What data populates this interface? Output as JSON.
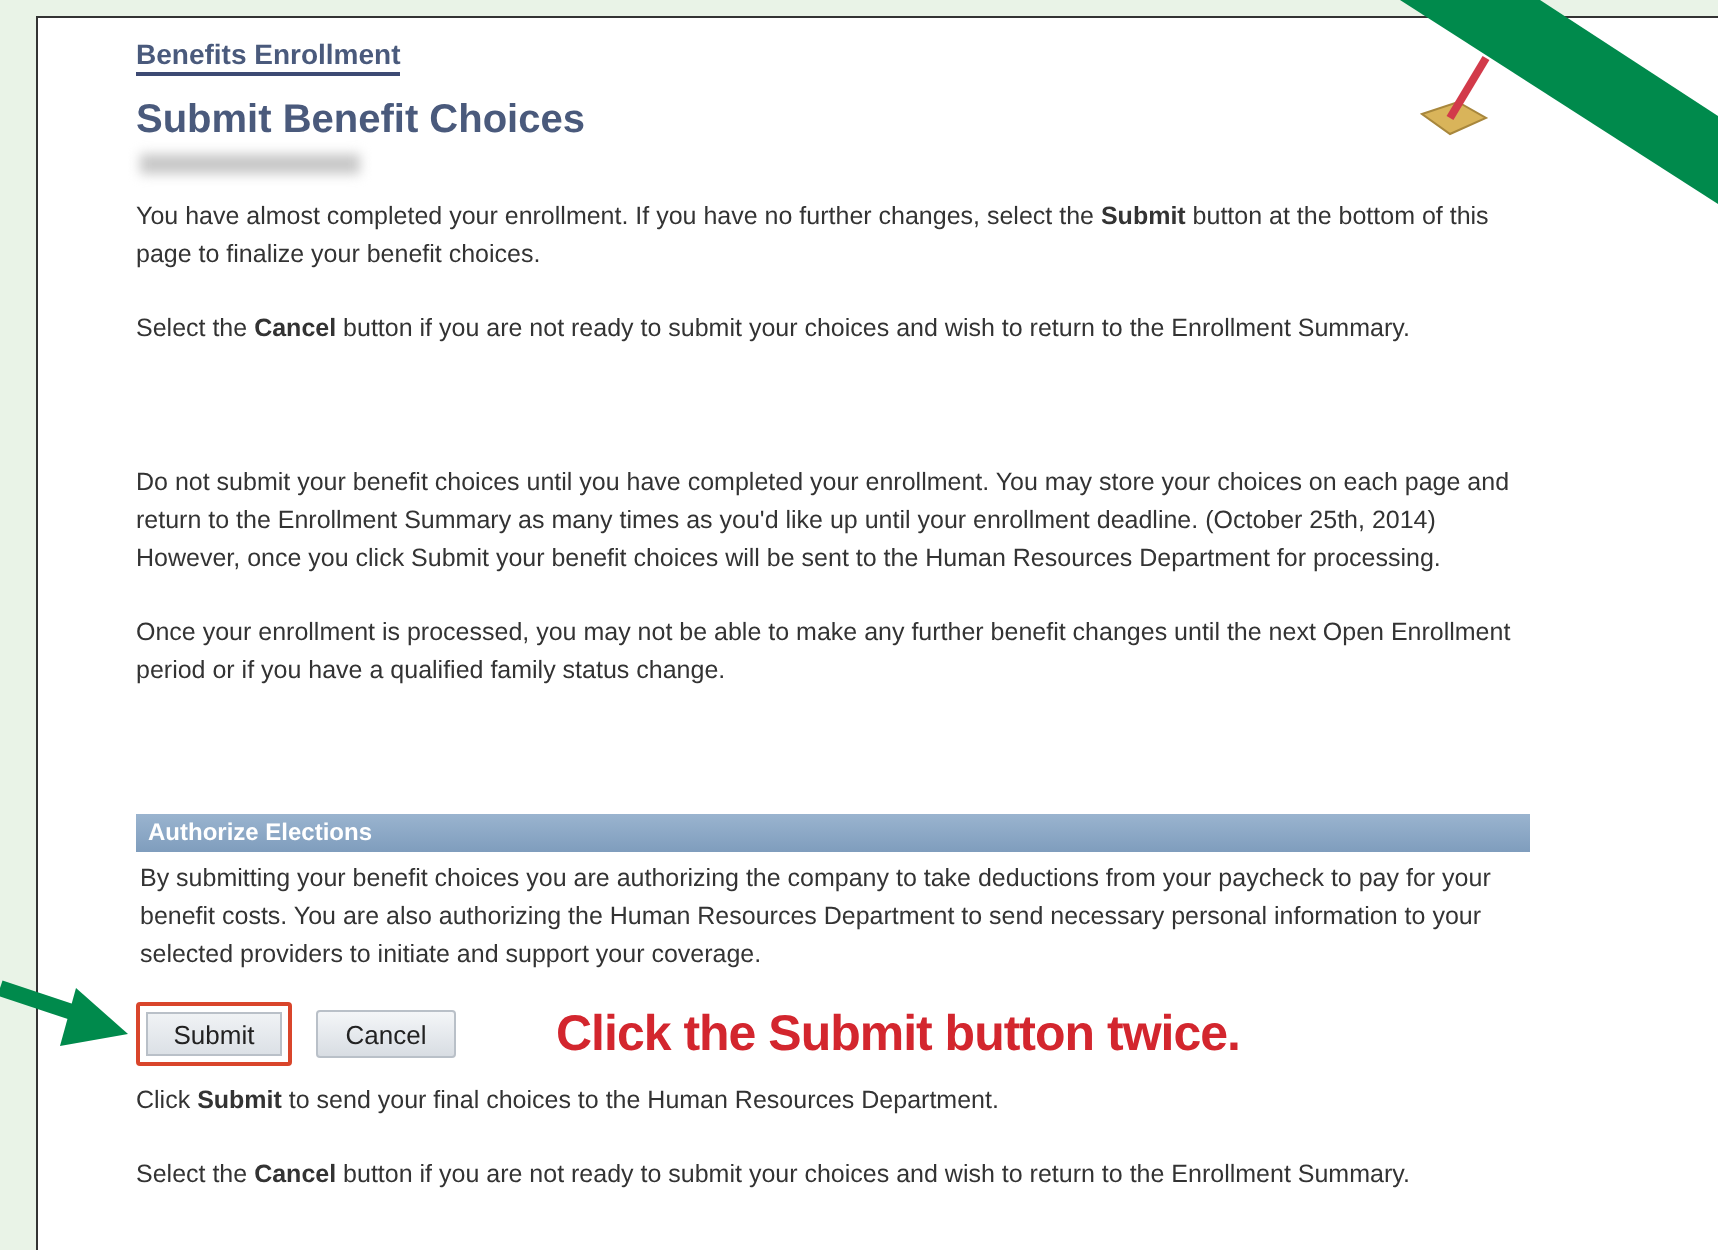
{
  "breadcrumb": "Benefits Enrollment",
  "title": "Submit Benefit Choices",
  "intro": [
    "You have almost completed your enrollment. If you have no further changes, select the **Submit** button at the bottom of this page to finalize your benefit choices.",
    "Select the **Cancel** button if you are not ready to submit your choices and wish to return to the Enrollment Summary.",
    "Do not submit your benefit choices until you have completed your enrollment. You may store your choices on each page and return to the Enrollment Summary as many times as you'd like up until your enrollment deadline. (October 25th, 2014) However, once you click Submit your benefit choices will be sent to the Human Resources Department for processing.",
    "Once your enrollment is processed, you may not be able to make any further benefit changes until the next Open Enrollment period or if you have a qualified family status change."
  ],
  "section": {
    "title": "Authorize Elections",
    "text": "By submitting your benefit choices you are authorizing the company to take deductions from your paycheck to pay for your benefit costs. You are also authorizing the Human Resources Department to send necessary personal information to your selected providers to initiate and support your coverage."
  },
  "buttons": [
    {
      "label": "Submit",
      "highlighted": true
    },
    {
      "label": "Cancel",
      "highlighted": false
    }
  ],
  "callout": "Click the Submit button twice.",
  "footer": [
    "Click **Submit** to send your final choices to the Human Resources Department.",
    "Select the **Cancel** button if you are not ready to submit your choices and wish to return to the Enrollment Summary."
  ]
}
